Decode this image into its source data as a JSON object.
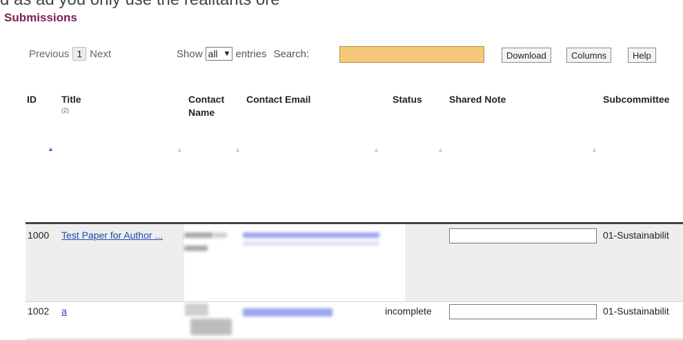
{
  "top_clip": "d as ad you only use the realitants ore",
  "heading": "Submissions",
  "pager": {
    "previous": "Previous",
    "page": "1",
    "next": "Next"
  },
  "length": {
    "show": "Show",
    "value": "all",
    "entries": "entries"
  },
  "search": {
    "label": "Search:",
    "value": ""
  },
  "buttons": {
    "download": "Download",
    "columns": "Columns",
    "help": "Help"
  },
  "columns": {
    "id": "ID",
    "title": "Title",
    "title_count": "(2)",
    "contact_name_line1": "Contact",
    "contact_name_line2": "Name",
    "contact_email": "Contact Email",
    "status": "Status",
    "shared_note": "Shared Note",
    "subcommittee": "Subcommittee"
  },
  "rows": [
    {
      "id": "1000",
      "title": "Test Paper for Author ...",
      "status": "",
      "note": "",
      "subcommittee": "01-Sustainabilit"
    },
    {
      "id": "1002",
      "title": "a",
      "status": "incomplete",
      "note": "",
      "subcommittee": "01-Sustainabilit"
    }
  ],
  "colors": {
    "heading": "#7a1f52",
    "search_bg": "#f6c97a",
    "link": "#1f47b0"
  }
}
